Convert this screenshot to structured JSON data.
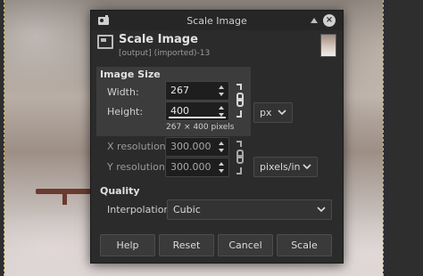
{
  "window": {
    "title": "Scale Image",
    "colors": {
      "dialog_bg": "#2b2b2b",
      "section_highlight": "#3c3c3c",
      "chain_color": "#d8d8d8"
    }
  },
  "header": {
    "title": "Scale Image",
    "subtitle": "[output] (imported)-13"
  },
  "image_size": {
    "section_label": "Image Size",
    "width_label": "Width:",
    "width_value": "267",
    "height_label": "Height:",
    "height_value": "400",
    "unit": "px",
    "info": "267 × 400 pixels",
    "x_res_label": "X resolution:",
    "x_res_value": "300.000",
    "y_res_label": "Y resolution:",
    "y_res_value": "300.000",
    "res_unit": "pixels/in"
  },
  "quality": {
    "section_label": "Quality",
    "interpolation_label": "Interpolation:",
    "interpolation_value": "Cubic"
  },
  "buttons": {
    "help": "Help",
    "reset": "Reset",
    "cancel": "Cancel",
    "scale": "Scale"
  },
  "icons": [
    "app-icon",
    "scale-image-icon",
    "image-thumbnail",
    "chain-link-icon",
    "chevron-down-icon",
    "close-icon",
    "minimize-icon"
  ]
}
